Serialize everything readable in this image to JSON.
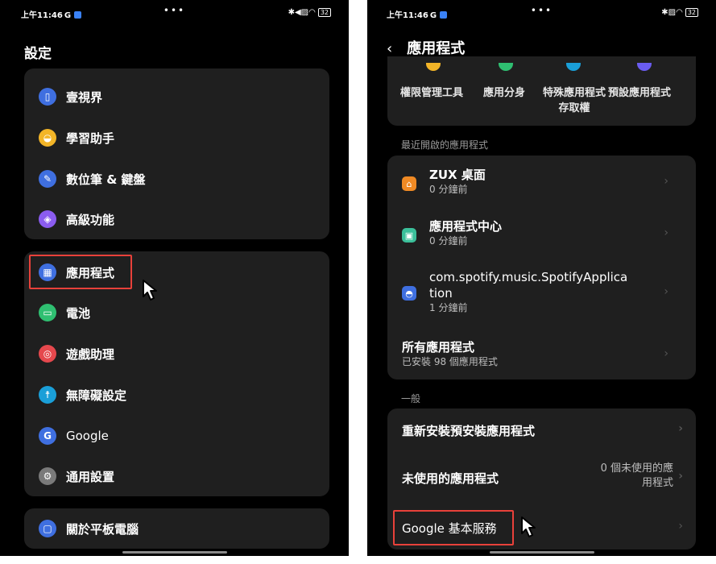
{
  "left": {
    "status": {
      "time": "上午11:46",
      "g": "G",
      "dots": "•••",
      "right_icons": "✱◀▨◠",
      "battery": "32"
    },
    "title": "設定",
    "group1": [
      {
        "label": "壹視界",
        "icon": "view-icon",
        "color": "#3f6fe0"
      },
      {
        "label": "學習助手",
        "icon": "graduation-cap-icon",
        "color": "#f3b528"
      },
      {
        "label": "數位筆 & 鍵盤",
        "icon": "pen-icon",
        "color": "#3f6fe0"
      },
      {
        "label": "高級功能",
        "icon": "advanced-icon",
        "color": "#8b5cf0"
      }
    ],
    "group2": [
      {
        "label": "應用程式",
        "icon": "apps-grid-icon",
        "color": "#3f6fe0"
      },
      {
        "label": "電池",
        "icon": "battery-icon",
        "color": "#2fbf71"
      },
      {
        "label": "遊戲助理",
        "icon": "gamepad-icon",
        "color": "#e5484d"
      },
      {
        "label": "無障礙設定",
        "icon": "accessibility-icon",
        "color": "#1a9fd8"
      },
      {
        "label": "Google",
        "icon": "google-icon",
        "color": "#3f6fe0"
      },
      {
        "label": "通用設置",
        "icon": "gear-icon",
        "color": "#7a7a7a"
      }
    ],
    "group3": [
      {
        "label": "關於平板電腦",
        "icon": "tablet-icon",
        "color": "#3f6fe0"
      }
    ]
  },
  "right": {
    "status": {
      "time": "上午11:46",
      "g": "G",
      "dots": "•••",
      "right_icons": "✱▨◠",
      "battery": "32"
    },
    "title": "應用程式",
    "back": "‹",
    "shortcuts": [
      "權限管理工具",
      "應用分身",
      "特殊應用程式",
      "預設應用程式"
    ],
    "shortcut_second_line": "存取權",
    "recent_header": "最近開啟的應用程式",
    "recent_apps": [
      {
        "name": "ZUX 桌面",
        "sub": "0 分鐘前",
        "color": "#f08a24"
      },
      {
        "name": "應用程式中心",
        "sub": "0 分鐘前",
        "color": "#3bbf9a"
      },
      {
        "name_line1": "com.spotify.music.SpotifyApplica",
        "name_line2": "tion",
        "sub": "1 分鐘前",
        "color": "#3f6fe0"
      }
    ],
    "all_apps": {
      "name": "所有應用程式",
      "sub": "已安裝 98 個應用程式"
    },
    "general_header": "一般",
    "general": {
      "reinstall": "重新安裝預安裝應用程式",
      "unused": "未使用的應用程式",
      "unused_value_line1": "0 個未使用的應",
      "unused_value_line2": "用程式",
      "google_services": "Google 基本服務"
    },
    "chevron": "›"
  }
}
